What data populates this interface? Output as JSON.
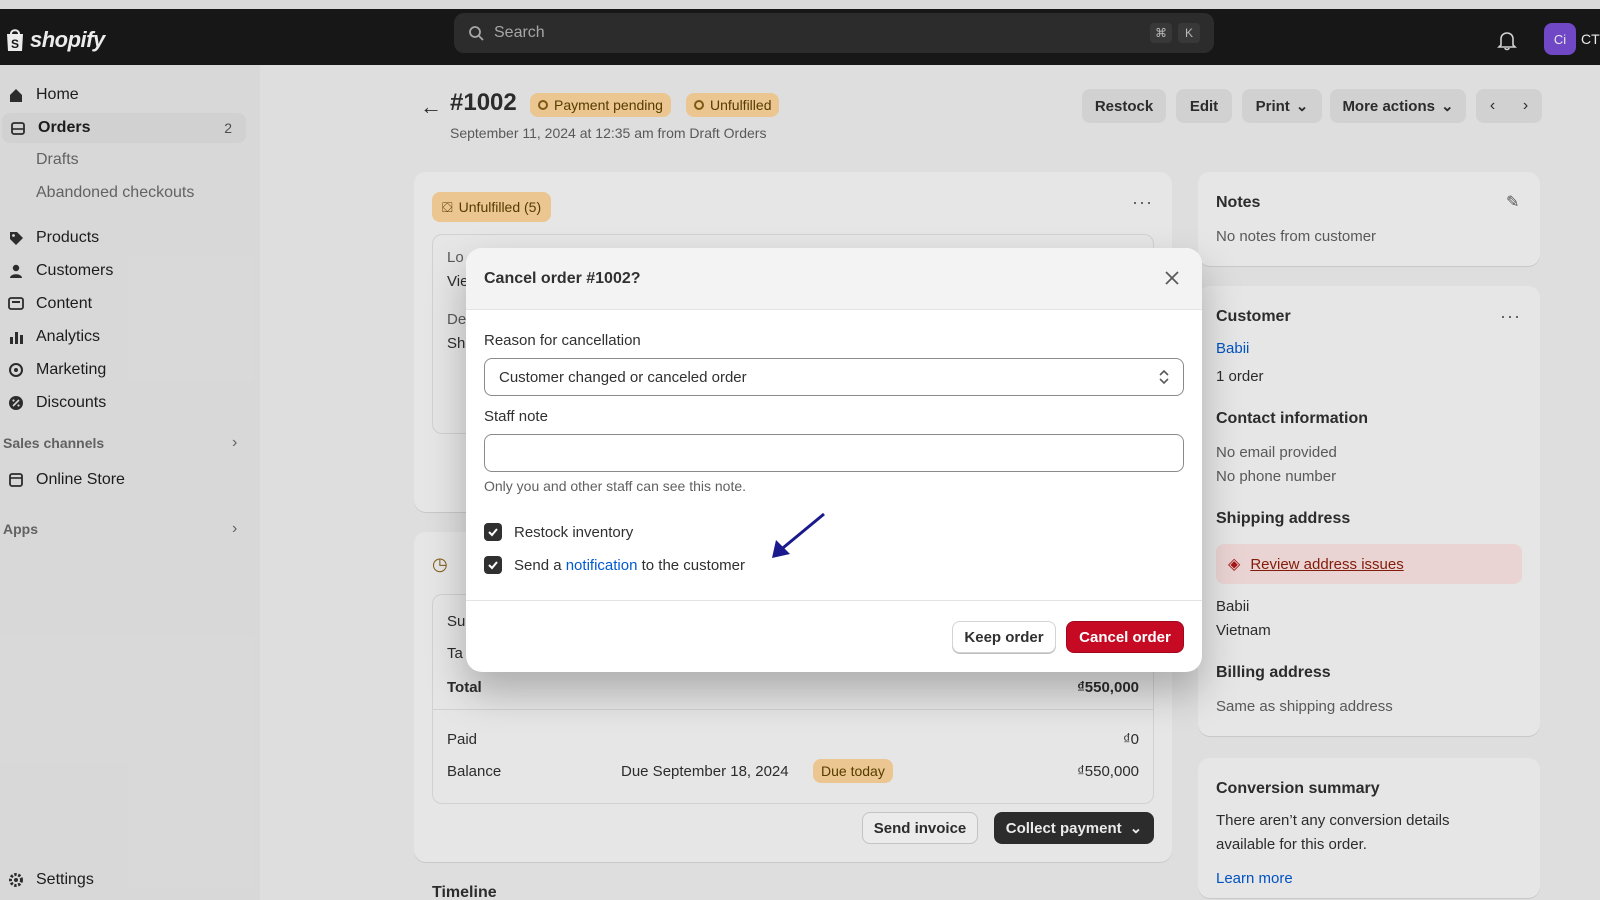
{
  "topbar": {
    "brand": "shopify",
    "search_placeholder": "Search",
    "shortcut_keys": [
      "⌘",
      "K"
    ],
    "avatar_initials": "Ci",
    "user_initials": "CT"
  },
  "sidebar": {
    "items": [
      {
        "label": "Home"
      },
      {
        "label": "Orders",
        "badge": "2"
      },
      {
        "label": "Drafts"
      },
      {
        "label": "Abandoned checkouts"
      },
      {
        "label": "Products"
      },
      {
        "label": "Customers"
      },
      {
        "label": "Content"
      },
      {
        "label": "Analytics"
      },
      {
        "label": "Marketing"
      },
      {
        "label": "Discounts"
      },
      {
        "label": "Online Store"
      },
      {
        "label": "Settings"
      }
    ],
    "sections": {
      "sales_channels": "Sales channels",
      "apps": "Apps"
    }
  },
  "order": {
    "title": "#1002",
    "payment_status": "Payment pending",
    "fulfillment_status": "Unfulfilled",
    "subtitle": "September 11, 2024 at 12:35 am from Draft Orders",
    "actions": {
      "restock": "Restock",
      "edit": "Edit",
      "print": "Print",
      "more": "More actions"
    }
  },
  "main": {
    "unfulfilled_badge": "Unfulfilled (5)",
    "partial_left": [
      "Lo",
      "Vie",
      "De",
      "Sh"
    ],
    "summary_partial": [
      "Su",
      "Ta"
    ],
    "total_label": "Total",
    "total_value": "₫550,000",
    "paid_label": "Paid",
    "paid_value": "₫0",
    "balance_label": "Balance",
    "balance_due": "Due September 18, 2024",
    "due_badge": "Due today",
    "balance_value": "₫550,000",
    "send_invoice": "Send invoice",
    "collect_payment": "Collect payment",
    "timeline": "Timeline"
  },
  "right": {
    "notes_title": "Notes",
    "notes_text": "No notes from customer",
    "customer_title": "Customer",
    "customer_name": "Babii",
    "customer_orders": "1 order",
    "contact_title": "Contact information",
    "contact_email": "No email provided",
    "contact_phone": "No phone number",
    "shipping_title": "Shipping address",
    "review_link": "Review address issues",
    "ship_name": "Babii",
    "ship_country": "Vietnam",
    "billing_title": "Billing address",
    "billing_text": "Same as shipping address",
    "conversion_title": "Conversion summary",
    "conversion_text_1": "There aren’t any conversion details",
    "conversion_text_2": "available for this order.",
    "learn_more": "Learn more"
  },
  "modal": {
    "title": "Cancel order #1002?",
    "reason_label": "Reason for cancellation",
    "reason_value": "Customer changed or canceled order",
    "staff_note_label": "Staff note",
    "staff_note_value": "",
    "staff_note_help": "Only you and other staff can see this note.",
    "restock_label": "Restock inventory",
    "restock_checked": true,
    "notify_prefix": "Send a",
    "notify_link": "notification",
    "notify_suffix": "to the customer",
    "notify_checked": true,
    "keep_button": "Keep order",
    "cancel_button": "Cancel order"
  },
  "colors": {
    "topbar": "#1a1a1a",
    "danger": "#c70a24",
    "link": "#005bd3",
    "warning_pill": "#ffd79d",
    "annotation_arrow": "#1a1a8c"
  }
}
